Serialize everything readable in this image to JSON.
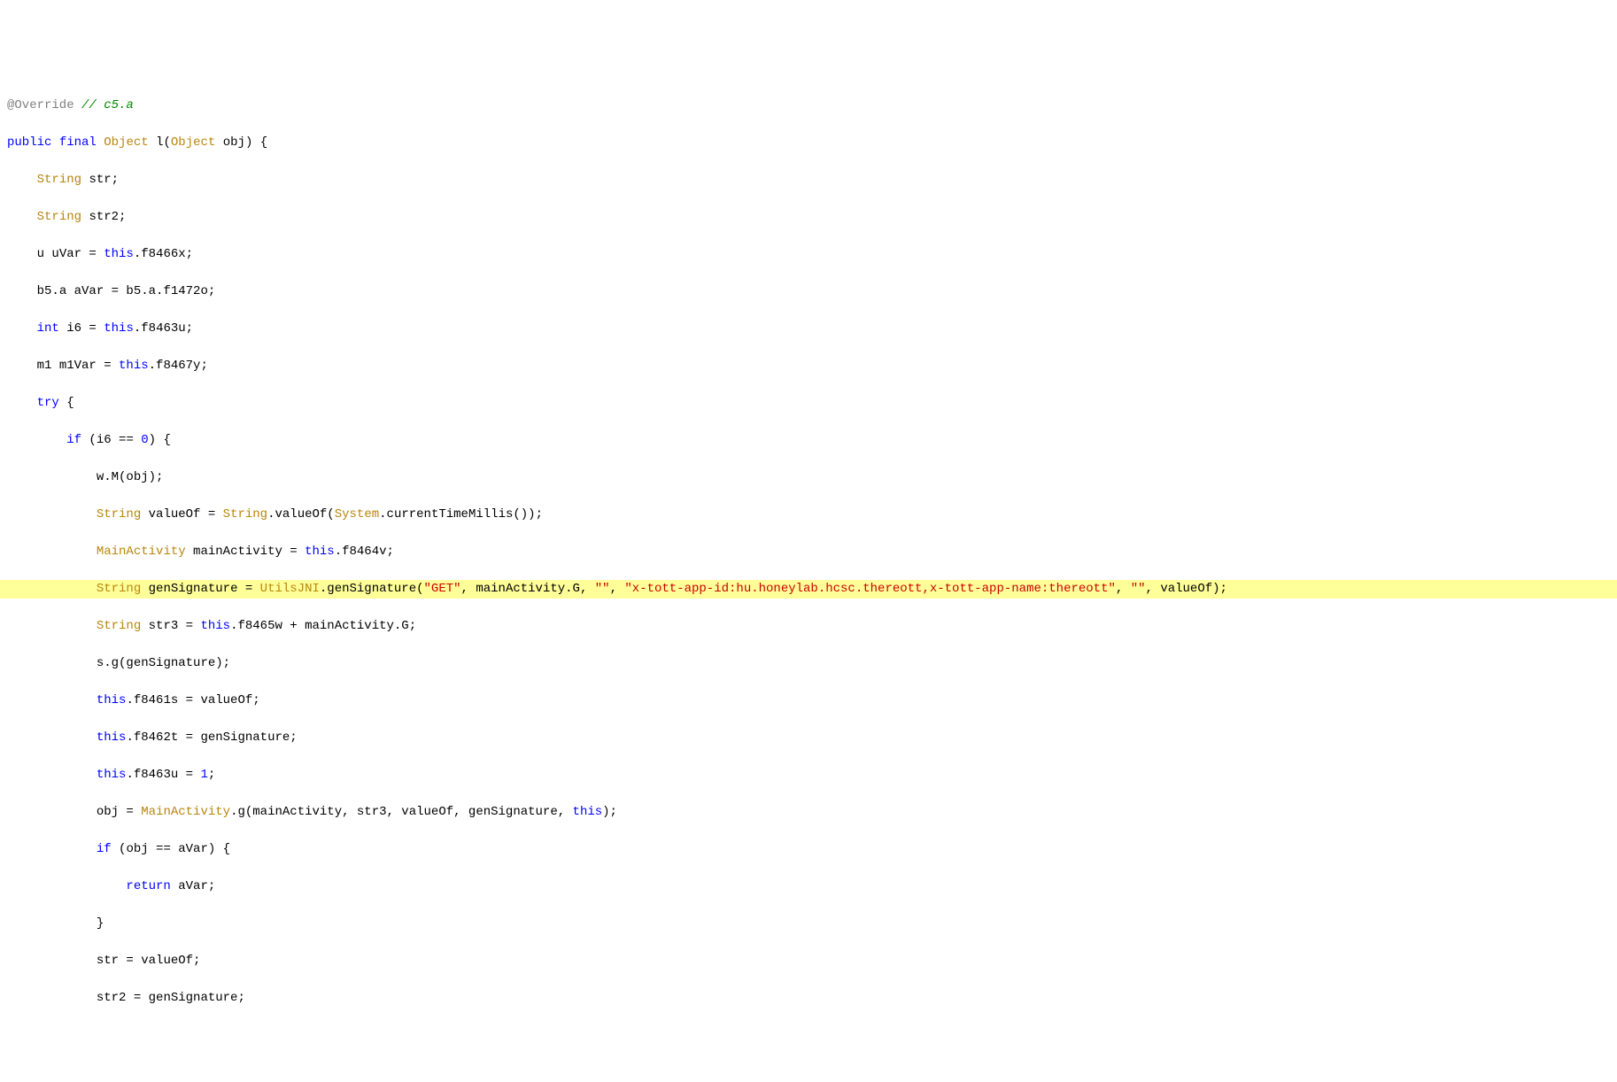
{
  "code": {
    "l1": {
      "annotation": "@Override",
      "comment": " // c5.a"
    },
    "l2": {
      "kw_public": "public",
      "kw_final": "final",
      "type_Object": "Object",
      "method_l": "l",
      "type_Object2": "Object",
      "param_obj": "obj",
      "brace": " {"
    },
    "l3": {
      "type": "String",
      "ident": "str;"
    },
    "l4": {
      "type": "String",
      "ident": "str2;"
    },
    "l5": {
      "ident_u": "u uVar = ",
      "kw_this": "this",
      "rest": ".f8466x;"
    },
    "l6": {
      "text": "b5.a aVar = b5.a.f1472o;"
    },
    "l7": {
      "kw_int": "int",
      "ident": " i6 = ",
      "kw_this": "this",
      "rest": ".f8463u;"
    },
    "l8": {
      "ident": "m1 m1Var = ",
      "kw_this": "this",
      "rest": ".f8467y;"
    },
    "l9": {
      "kw_try": "try",
      "brace": " {"
    },
    "l10": {
      "kw_if": "if",
      "cond_open": " (i6 == ",
      "num": "0",
      "cond_close": ") {"
    },
    "l11": {
      "text": "w.M(obj);"
    },
    "l12": {
      "type1": "String",
      "mid1": " valueOf = ",
      "type2": "String",
      "mid2": ".valueOf(",
      "type3": "System",
      "rest": ".currentTimeMillis());"
    },
    "l13": {
      "type": "MainActivity",
      "mid": " mainActivity = ",
      "kw_this": "this",
      "rest": ".f8464v;"
    },
    "l14": {
      "type": "String",
      "mid1": " genSignature = ",
      "type2": "UtilsJNI",
      "mid2": ".genSignature(",
      "str1": "\"GET\"",
      "sep1": ", mainActivity.G, ",
      "str2": "\"\"",
      "sep2": ", ",
      "str3": "\"x-tott-app-id:hu.honeylab.hcsc.thereott,x-tott-app-name:thereott\"",
      "sep3": ", ",
      "str4": "\"\"",
      "sep4": ", valueOf);"
    },
    "l15": {
      "type": "String",
      "mid": " str3 = ",
      "kw_this": "this",
      "rest": ".f8465w + mainActivity.G;"
    },
    "l16": {
      "text": "s.g(genSignature);"
    },
    "l17": {
      "kw_this": "this",
      "rest": ".f8461s = valueOf;"
    },
    "l18": {
      "kw_this": "this",
      "rest": ".f8462t = genSignature;"
    },
    "l19": {
      "kw_this": "this",
      "mid": ".f8463u = ",
      "num": "1",
      "rest": ";"
    },
    "l20": {
      "pre": "obj = ",
      "type": "MainActivity",
      "rest": ".g(mainActivity, str3, valueOf, genSignature, ",
      "kw_this": "this",
      "close": ");"
    },
    "l21": {
      "kw_if": "if",
      "rest": " (obj == aVar) {"
    },
    "l22": {
      "kw_return": "return",
      "rest": " aVar;"
    },
    "l23": {
      "brace": "}"
    },
    "l24": {
      "text": "str = valueOf;"
    },
    "l25": {
      "text": "str2 = genSignature;"
    }
  }
}
